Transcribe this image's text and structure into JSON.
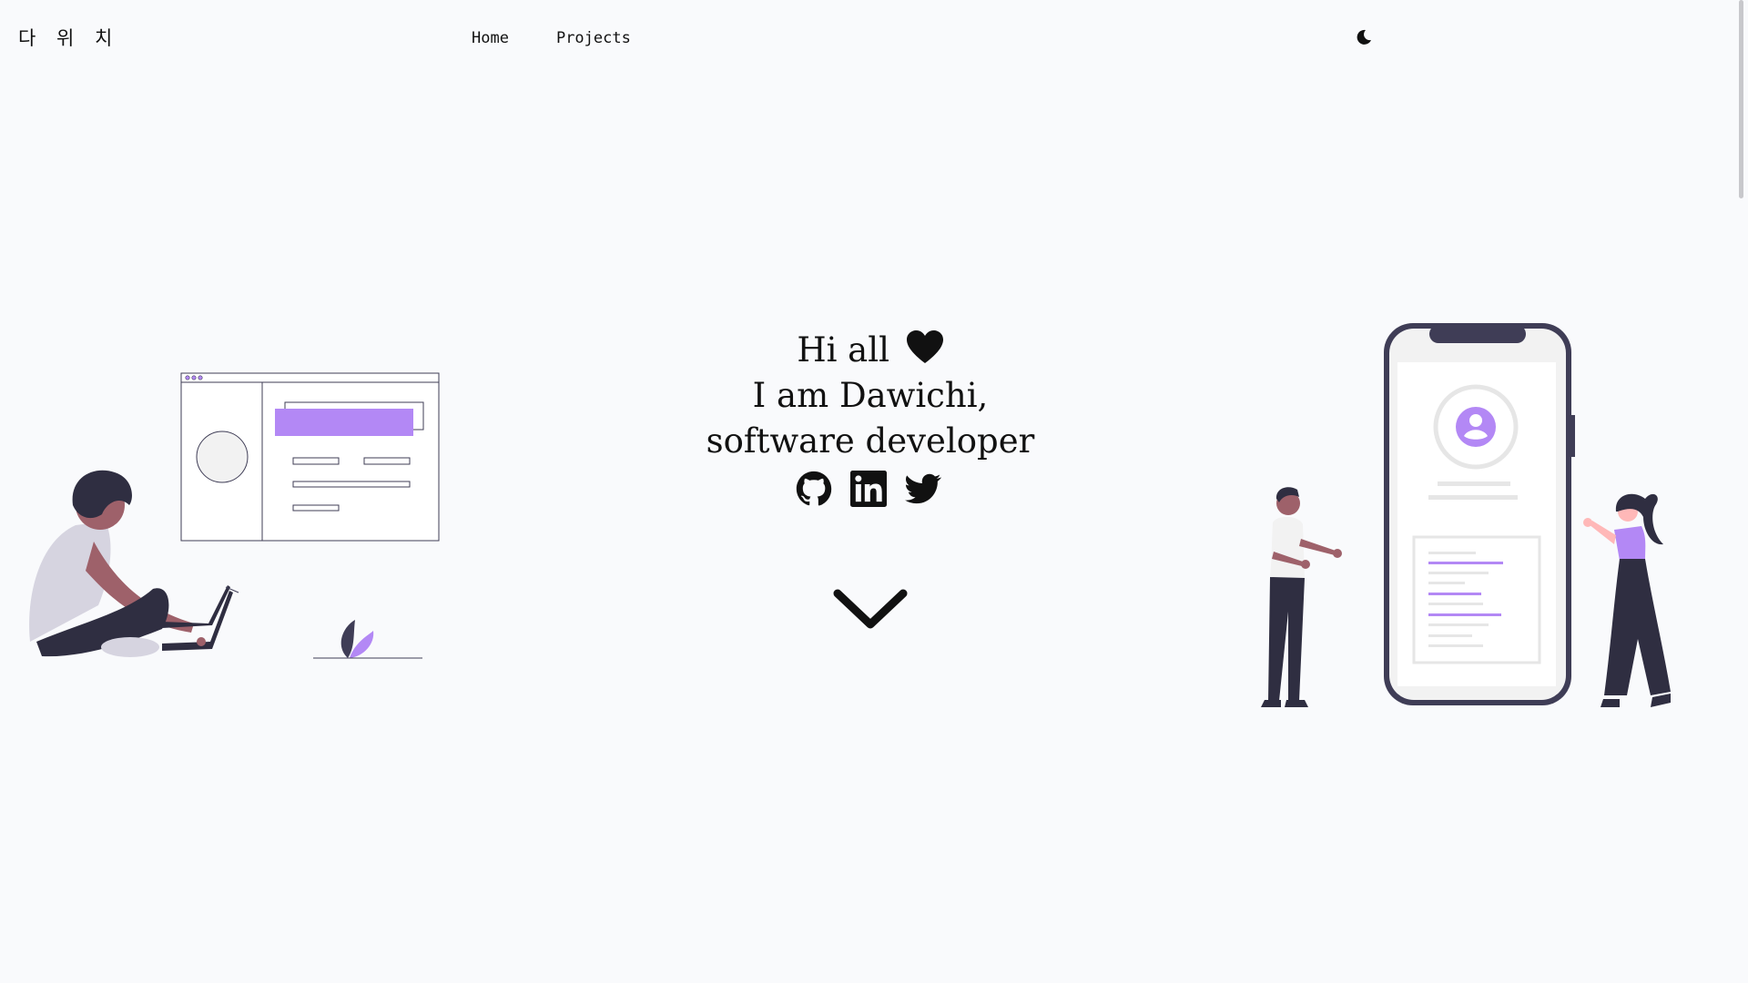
{
  "header": {
    "logo": "다 위 치",
    "nav": [
      {
        "label": "Home"
      },
      {
        "label": "Projects"
      }
    ],
    "theme_toggle_icon": "moon-icon"
  },
  "hero": {
    "line1": "Hi all",
    "line2": "I am Dawichi,",
    "line3": "software developer",
    "heart_icon": "heart-icon"
  },
  "socials": [
    {
      "icon": "github-icon"
    },
    {
      "icon": "linkedin-icon"
    },
    {
      "icon": "twitter-icon"
    }
  ],
  "scroll_icon": "chevron-down-icon",
  "colors": {
    "background": "#f9fafc",
    "accent": "#b388f5",
    "dark": "#3f3d56",
    "text": "#111111"
  }
}
